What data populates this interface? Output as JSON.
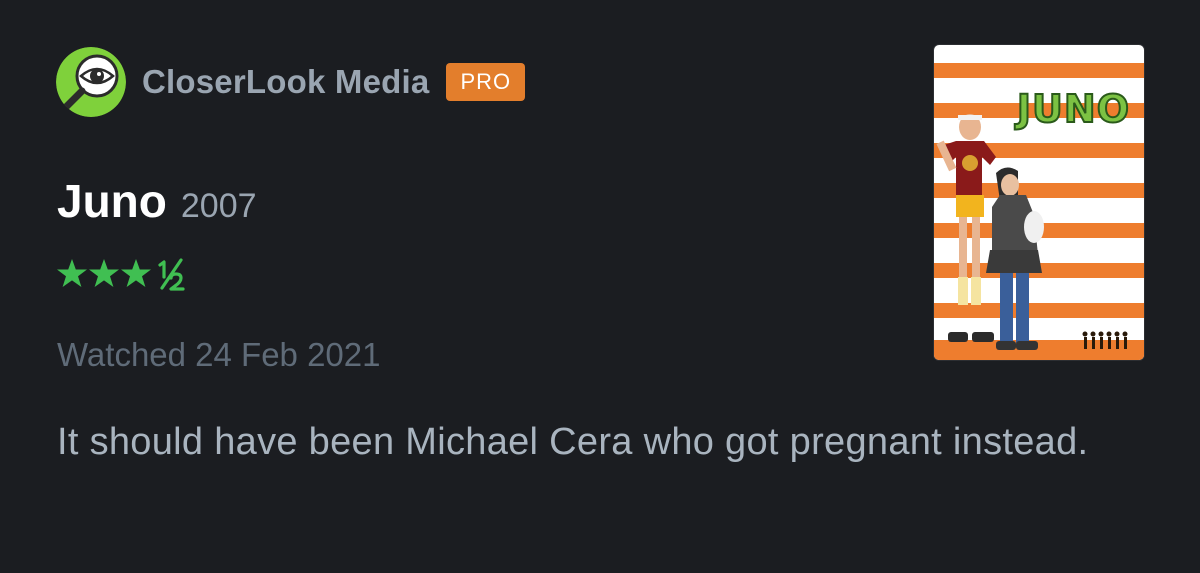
{
  "author": {
    "name": "CloserLook Media",
    "badge": "PRO",
    "avatar_icon": "magnifier-eye-icon",
    "avatar_color": "#7fd13b"
  },
  "film": {
    "title": "Juno",
    "year": "2007"
  },
  "rating": {
    "stars": 3.5,
    "max": 5,
    "color": "#40bf52"
  },
  "watched": "Watched 24 Feb 2021",
  "review": "It should have been Michael Cera who got pregnant instead.",
  "poster": {
    "title": "JUNO",
    "stripe_color": "#ee7d2e"
  },
  "colors": {
    "background": "#1b1d21",
    "badge": "#e37e2c"
  }
}
